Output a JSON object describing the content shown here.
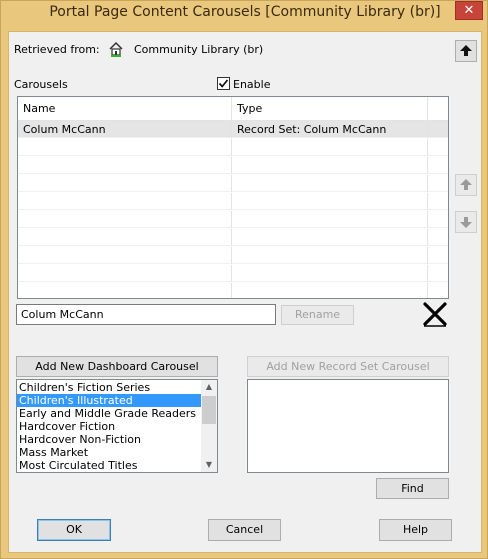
{
  "window": {
    "title": "Portal Page Content Carousels [Community Library  (br)]",
    "close_glyph": "✕"
  },
  "retrieved": {
    "label": "Retrieved from:",
    "icon": "home-icon",
    "value": "Community Library  (br)"
  },
  "carousels": {
    "label": "Carousels",
    "enable_label": "Enable",
    "enable_checked": true,
    "columns": [
      "Name",
      "Type"
    ],
    "rows": [
      {
        "name": "Colum McCann",
        "type": "Record Set: Colum McCann",
        "selected": true
      }
    ]
  },
  "name_field": {
    "value": "Colum McCann"
  },
  "buttons": {
    "rename": "Rename",
    "add_dashboard": "Add New Dashboard Carousel",
    "add_record_set": "Add New Record Set Carousel",
    "find": "Find",
    "ok": "OK",
    "cancel": "Cancel",
    "help": "Help"
  },
  "dashboard_list": {
    "items": [
      "Children's Fiction Series",
      "Children's Illustrated",
      "Early and Middle Grade Readers",
      "Hardcover Fiction",
      "Hardcover Non-Fiction",
      "Mass Market",
      "Most Circulated Titles"
    ],
    "selected_index": 1
  },
  "colors": {
    "title_bar": "#e9c77c",
    "selection": "#3399ff",
    "close_button": "#c7443a"
  }
}
